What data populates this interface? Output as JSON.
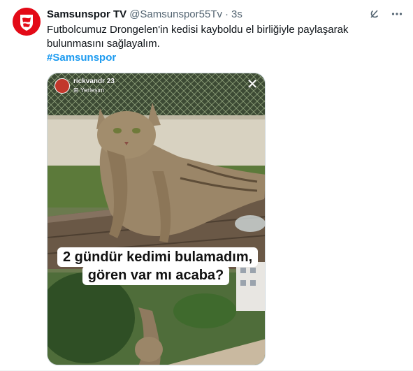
{
  "tweet": {
    "display_name": "Samsunspor TV",
    "handle": "@Samsunspor55Tv",
    "separator": "·",
    "time": "3s",
    "text": "Futbolcumuz Drongelen'in kedisi kayboldu el birliğiyle paylaşarak bulunmasını sağlayalım.",
    "hashtag": "#Samsunspor",
    "icons": {
      "grok": "grok-icon",
      "more": "more-icon",
      "avatar": "samsunspor-logo"
    }
  },
  "media": {
    "story_user": "rickvandr",
    "story_time": "23",
    "story_location": "Yerleşim",
    "close_symbol": "✕",
    "caption_line1": "2 gündür kedimi bulamadım,",
    "caption_line2": "gören var mı acaba?"
  },
  "colors": {
    "brand_red": "#e30a17",
    "link_blue": "#1d9bf0",
    "secondary_text": "#536471"
  }
}
